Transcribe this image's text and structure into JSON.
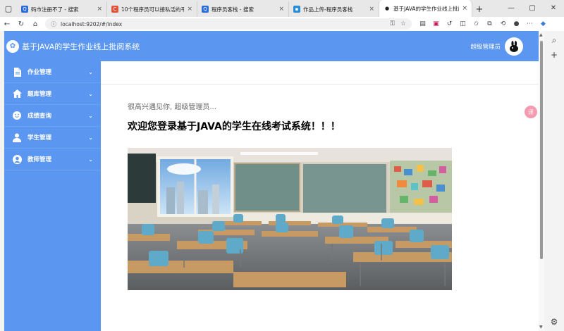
{
  "browser": {
    "tabs": [
      {
        "title": "码市注册不了 - 搜索",
        "fav_color": "#2b6cd6"
      },
      {
        "title": "10个程序员可以接私活的平台和...",
        "fav_color": "#e0553a"
      },
      {
        "title": "程序员客栈 - 搜索",
        "fav_color": "#2b6cd6"
      },
      {
        "title": "作品上传-程序员客栈",
        "fav_color": "#2a8bd8"
      },
      {
        "title": "基于JAVA的学生作业线上批阅系统",
        "fav_color": "#222222"
      }
    ],
    "url": "localhost:9202/#/index"
  },
  "app": {
    "title": "基于JAVA的学生作业线上批阅系统",
    "admin_label": "超级管理员"
  },
  "sidebar": {
    "items": [
      {
        "label": "作业管理",
        "icon": "document-icon"
      },
      {
        "label": "题库管理",
        "icon": "home-icon"
      },
      {
        "label": "成绩查询",
        "icon": "smile-icon"
      },
      {
        "label": "学生管理",
        "icon": "user-icon"
      },
      {
        "label": "教师管理",
        "icon": "teacher-icon"
      }
    ]
  },
  "main": {
    "greeting": "很高兴遇见你, 超级管理员...",
    "welcome": "欢迎您登录基于JAVA的学生在线考试系统！！！"
  },
  "colors": {
    "accent": "#5b96f0"
  }
}
